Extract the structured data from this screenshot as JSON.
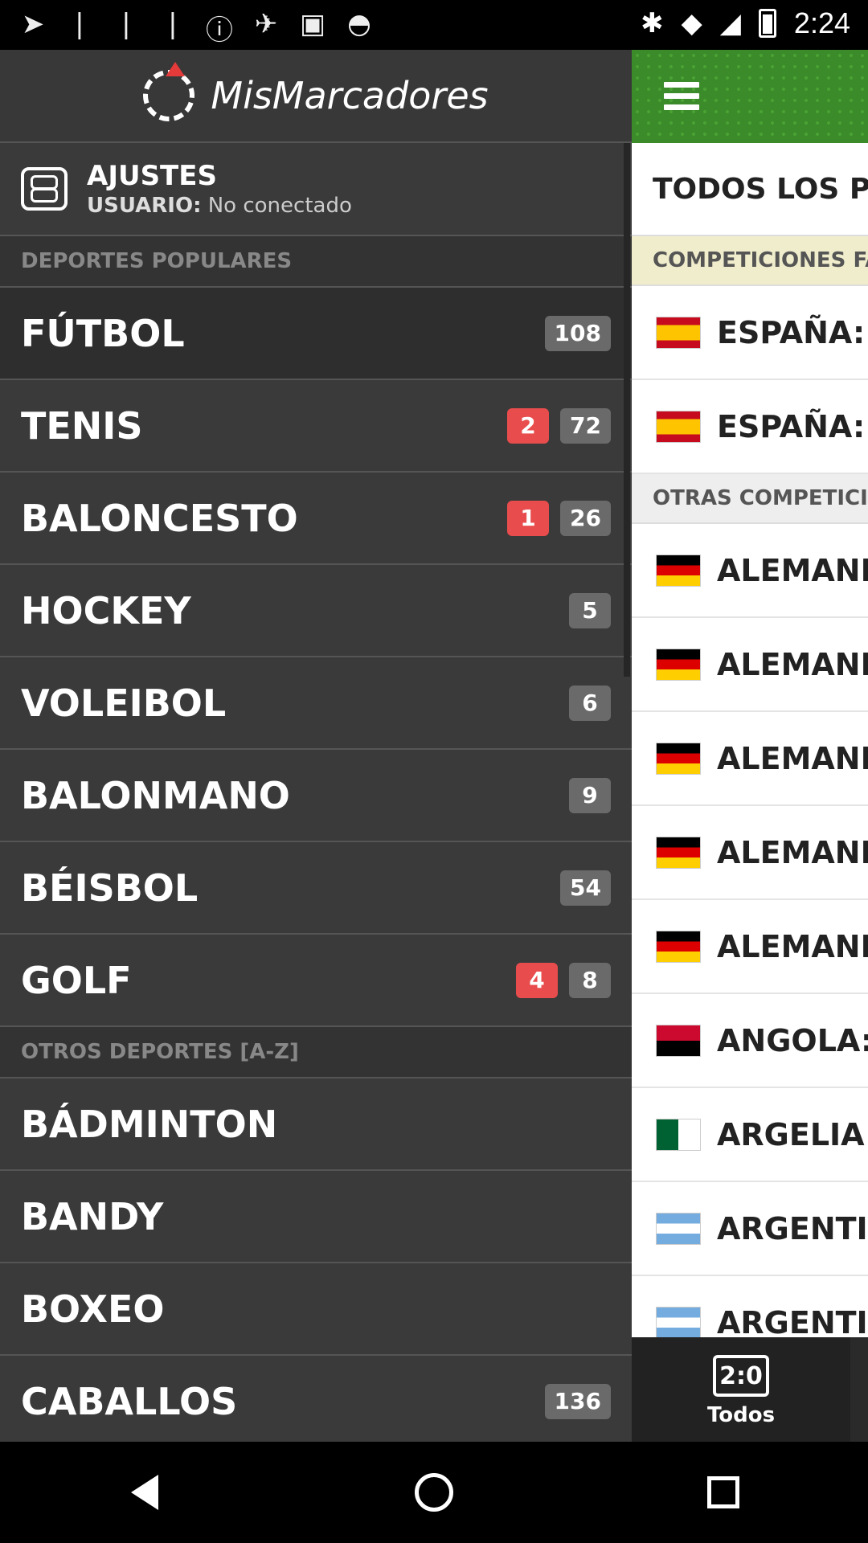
{
  "status": {
    "time": "2:24"
  },
  "header": {
    "logo_text": "MisMarcadores"
  },
  "settings": {
    "title": "AJUSTES",
    "user_label": "USUARIO:",
    "user_value": "No conectado"
  },
  "drawer": {
    "popular_title": "DEPORTES POPULARES",
    "popular": [
      {
        "label": "FÚTBOL",
        "live": "",
        "count": "108"
      },
      {
        "label": "TENIS",
        "live": "2",
        "count": "72"
      },
      {
        "label": "BALONCESTO",
        "live": "1",
        "count": "26"
      },
      {
        "label": "HOCKEY",
        "live": "",
        "count": "5"
      },
      {
        "label": "VOLEIBOL",
        "live": "",
        "count": "6"
      },
      {
        "label": "BALONMANO",
        "live": "",
        "count": "9"
      },
      {
        "label": "BÉISBOL",
        "live": "",
        "count": "54"
      },
      {
        "label": "GOLF",
        "live": "4",
        "count": "8"
      }
    ],
    "others_title": "OTROS DEPORTES [A-Z]",
    "others": [
      {
        "label": "BÁDMINTON",
        "count": ""
      },
      {
        "label": "BANDY",
        "count": ""
      },
      {
        "label": "BOXEO",
        "count": ""
      },
      {
        "label": "CABALLOS",
        "count": "136"
      }
    ]
  },
  "main": {
    "heading": "TODOS LOS PA",
    "fav_section": "COMPETICIONES FA",
    "fav": [
      {
        "flag": "es",
        "name": "ESPAÑA: L"
      },
      {
        "flag": "es",
        "name": "ESPAÑA: L"
      }
    ],
    "other_section": "OTRAS COMPETICIO",
    "other": [
      {
        "flag": "de",
        "name": "ALEMANIA"
      },
      {
        "flag": "de",
        "name": "ALEMANIA"
      },
      {
        "flag": "de",
        "name": "ALEMANIA"
      },
      {
        "flag": "de",
        "name": "ALEMANIA"
      },
      {
        "flag": "de",
        "name": "ALEMANIA"
      },
      {
        "flag": "ao",
        "name": "ANGOLA: ("
      },
      {
        "flag": "dz",
        "name": "ARGELIA:"
      },
      {
        "flag": "ar",
        "name": "ARGENTIN"
      },
      {
        "flag": "ar",
        "name": "ARGENTIN"
      }
    ]
  },
  "bottom_tab": {
    "icon_text": "2:0",
    "label": "Todos"
  }
}
